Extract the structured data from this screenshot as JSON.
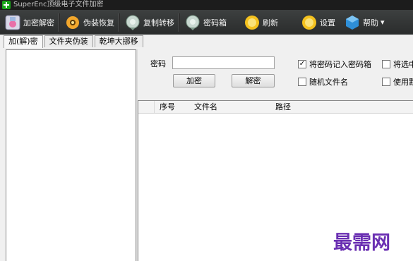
{
  "window": {
    "title": "SuperEnc顶级电子文件加密"
  },
  "toolbar": {
    "items": [
      {
        "label": "加密解密",
        "icon": "encrypt-decrypt-icon"
      },
      {
        "label": "伪装恢复",
        "icon": "gear-flower-icon"
      },
      {
        "label": "复制转移",
        "icon": "copy-move-icon"
      },
      {
        "label": "密码箱",
        "icon": "password-box-icon"
      },
      {
        "label": "刷新",
        "icon": "refresh-icon"
      },
      {
        "label": "设置",
        "icon": "settings-icon"
      },
      {
        "label": "帮助",
        "icon": "help-icon"
      }
    ],
    "help_arrow": "▾"
  },
  "tabs": [
    {
      "label": "加(解)密",
      "active": true
    },
    {
      "label": "文件夹伪装",
      "active": false
    },
    {
      "label": "乾坤大挪移",
      "active": false
    }
  ],
  "form": {
    "password_label": "密码",
    "password_value": "",
    "encrypt_button": "加密",
    "decrypt_button": "解密",
    "checkboxes": [
      {
        "label": "将密码记入密码箱",
        "checked": true,
        "mark": "✓"
      },
      {
        "label": "将选中",
        "checked": false,
        "mark": ""
      },
      {
        "label": "随机文件名",
        "checked": false,
        "mark": ""
      },
      {
        "label": "使用默",
        "checked": false,
        "mark": ""
      }
    ]
  },
  "grid": {
    "columns": [
      "",
      "序号",
      "文件名",
      "路径"
    ]
  },
  "watermark": "最需网",
  "colors": {
    "titlebar_bg": "#1c1c1c",
    "toolbar_bg": "#333535",
    "watermark": "#6a2fb2"
  }
}
